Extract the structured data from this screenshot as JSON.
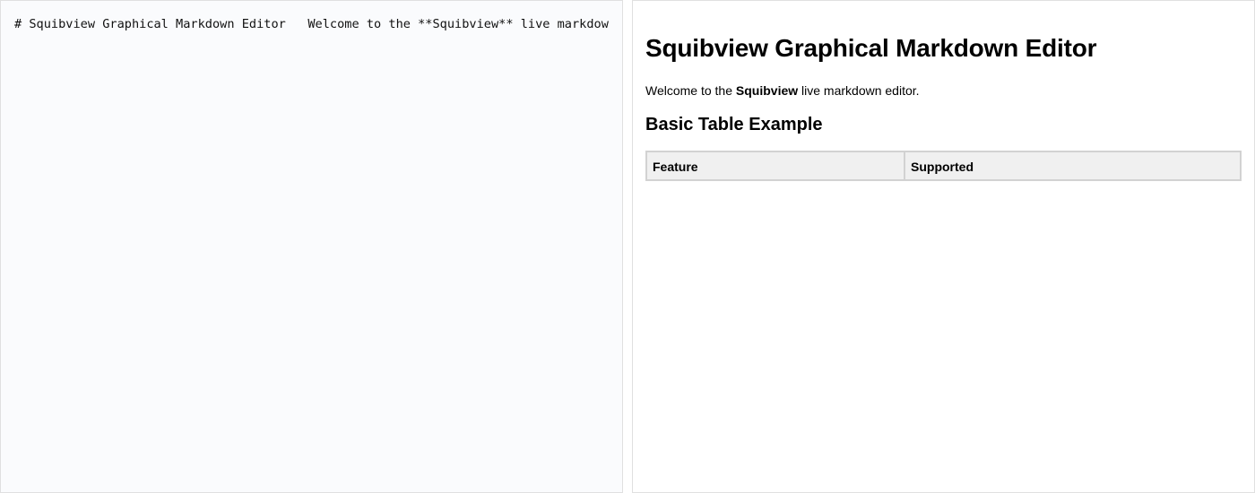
{
  "editor": {
    "source_text": "# Squibview Graphical Markdown Editor   Welcome to the **Squibview** live markdown editor.   ## Basic Table Example   | Feature | Supported |"
  },
  "preview": {
    "title": "Squibview Graphical Markdown Editor",
    "intro": {
      "before": "Welcome to the ",
      "bold": "Squibview",
      "after": " live markdown editor."
    },
    "section_heading": "Basic Table Example",
    "table": {
      "headers": [
        "Feature",
        "Supported"
      ]
    }
  },
  "colors": {
    "editor_background": "#fafbfd",
    "pane_border": "#e0e0e0",
    "table_header_background": "#f0f0f0",
    "table_border": "#d2d2d2"
  }
}
